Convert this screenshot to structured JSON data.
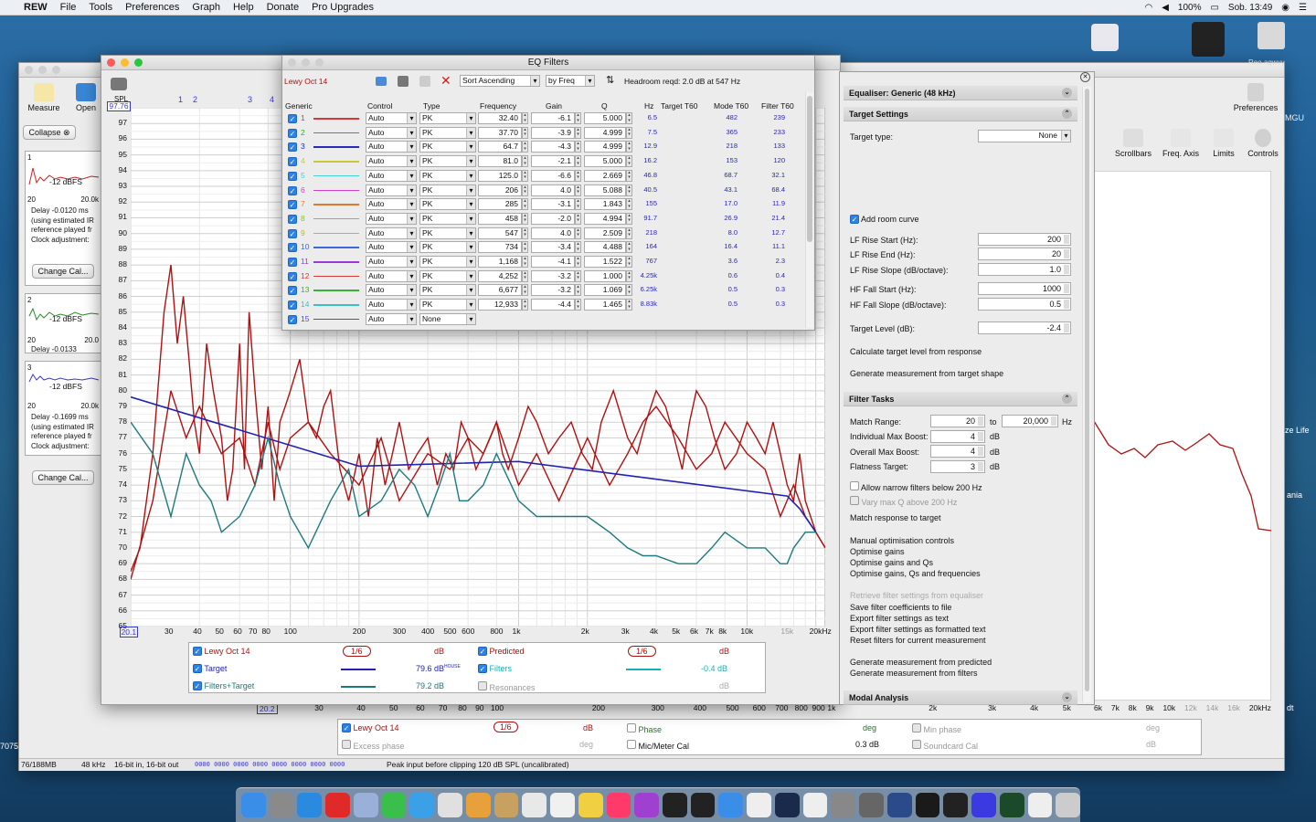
{
  "menubar": {
    "app": "REW",
    "items": [
      "File",
      "Tools",
      "Preferences",
      "Graph",
      "Help",
      "Donate",
      "Pro Upgrades"
    ],
    "battery": "100%",
    "clock": "Sob. 13:49"
  },
  "main_window": {
    "toolbar_left": {
      "measure": "Measure",
      "open": "Open",
      "collapse": "Collapse"
    },
    "toolbar_right": {
      "preferences": "Preferences",
      "scrollbars": "Scrollbars",
      "freq_axis": "Freq. Axis",
      "limits": "Limits",
      "controls": "Controls"
    },
    "thumbs": [
      {
        "num": "1",
        "level": "-12 dBFS",
        "lo": "20",
        "hi": "20.0k",
        "text": "Delay -0.0120 ms (using estimated IR reference played fr Clock adjustment:",
        "btn": "Change Cal..."
      },
      {
        "num": "2",
        "level": "-12 dBFS",
        "lo": "20",
        "hi": "20.0",
        "text": "Delay -0.0133",
        "btn": ""
      },
      {
        "num": "3",
        "level": "-12 dBFS",
        "lo": "20",
        "hi": "20.0k",
        "text": "Delay -0.1699 ms (using estimated IR reference played fr Clock adjustment:",
        "btn": "Change Cal..."
      }
    ],
    "status": {
      "mem": "76/188MB",
      "rate": "48 kHz",
      "bits": "16-bit in, 16-bit out",
      "bin": "0000 0000  0000 0000  0000 0000  0000 0000",
      "peak": "Peak input before clipping 120 dB SPL (uncalibrated)"
    },
    "bottom_axis": [
      "20.2",
      "30",
      "40",
      "50",
      "60",
      "70",
      "80",
      "90",
      "100",
      "200",
      "300",
      "400",
      "500",
      "600",
      "700",
      "800",
      "900",
      "1k",
      "2k",
      "3k",
      "4k",
      "5k",
      "6k",
      "7k",
      "8k",
      "9k",
      "10k",
      "12k",
      "14k",
      "16k",
      "20kHz"
    ],
    "bottom_legend": [
      {
        "label": "Lewy Oct 14",
        "value": "dB",
        "ctrl": "1/6",
        "checked": true,
        "color": "#b01010"
      },
      {
        "label": "Phase",
        "value": "deg",
        "checked": false,
        "color": "#1d7a1d"
      },
      {
        "label": "Min phase",
        "value": "deg",
        "checked": true,
        "disabled": true
      },
      {
        "label": "Excess phase",
        "value": "deg",
        "checked": true,
        "disabled": true
      },
      {
        "label": "Mic/Meter Cal",
        "value": "0.3 dB",
        "checked": false
      },
      {
        "label": "Soundcard Cal",
        "value": "dB",
        "checked": true,
        "disabled": true
      }
    ],
    "side_text": {
      "a": "Reo agwyy",
      "b": "MGU",
      "c": "ze Life",
      "d": "ania",
      "e": "dt",
      "f": "7075"
    }
  },
  "graph_window": {
    "spl_label": "SPL",
    "cursor_value": "97.76",
    "markers": [
      "1",
      "2",
      "3",
      "4"
    ],
    "y_ticks": [
      "97",
      "96",
      "95",
      "94",
      "93",
      "92",
      "91",
      "90",
      "89",
      "88",
      "87",
      "86",
      "85",
      "84",
      "83",
      "82",
      "81",
      "80",
      "79",
      "78",
      "77",
      "76",
      "75",
      "74",
      "73",
      "72",
      "71",
      "70",
      "69",
      "68",
      "67",
      "66",
      "65"
    ],
    "x_ticks": [
      "20.1",
      "30",
      "40",
      "50",
      "60",
      "70",
      "80",
      "100",
      "200",
      "300",
      "400",
      "500",
      "600",
      "800",
      "1k",
      "2k",
      "3k",
      "4k",
      "5k",
      "6k",
      "7k",
      "8k",
      "10k",
      "15k",
      "20kHz"
    ],
    "legend": [
      {
        "label": "Lewy Oct 14",
        "ctrl": "1/6",
        "value": "dB",
        "color": "#b01010"
      },
      {
        "label": "Predicted",
        "ctrl": "1/6",
        "value": "dB",
        "color": "#b01010"
      },
      {
        "label": "Target",
        "value": "79.6 dB",
        "sup": "HOUSE",
        "color": "#2222b0"
      },
      {
        "label": "Filters",
        "value": "-0.4 dB",
        "color": "#1bb0b0"
      },
      {
        "label": "Filters+Target",
        "value": "79.2 dB",
        "color": "#1b7a80"
      },
      {
        "label": "Resonances",
        "value": "dB",
        "color": "#999999"
      }
    ]
  },
  "eq_window": {
    "title": "EQ Filters",
    "measurement": "Lewy Oct 14",
    "sort": "Sort Ascending",
    "by": "by Freq",
    "headroom": "Headroom reqd:   2.0 dB at 547 Hz",
    "headers": [
      "Generic",
      "Control",
      "Type",
      "Frequency",
      "Gain",
      "Q",
      "Hz",
      "Target T60",
      "Mode T60",
      "Filter T60"
    ],
    "rows": [
      {
        "n": "1",
        "color": "#d23a3a",
        "control": "Auto",
        "type": "PK",
        "freq": "32.40",
        "gain": "-6.1",
        "q": "5.000",
        "hz": "6.5",
        "mode": "482",
        "filter": "239"
      },
      {
        "n": "2",
        "color": "#3aa33a",
        "control": "Auto",
        "type": "PK",
        "freq": "37.70",
        "gain": "-3.9",
        "q": "4.999",
        "hz": "7.5",
        "mode": "365",
        "filter": "233"
      },
      {
        "n": "3",
        "color": "#2a2ab8",
        "control": "Auto",
        "type": "PK",
        "freq": "64.7",
        "gain": "-4.3",
        "q": "4.999",
        "hz": "12.9",
        "mode": "218",
        "filter": "133"
      },
      {
        "n": "4",
        "color": "#c8c83a",
        "control": "Auto",
        "type": "PK",
        "freq": "81.0",
        "gain": "-2.1",
        "q": "5.000",
        "hz": "16.2",
        "mode": "153",
        "filter": "120"
      },
      {
        "n": "5",
        "color": "#45d0d0",
        "control": "Auto",
        "type": "PK",
        "freq": "125.0",
        "gain": "-6.6",
        "q": "2.669",
        "hz": "46.8",
        "mode": "68.7",
        "filter": "32.1"
      },
      {
        "n": "6",
        "color": "#d040d0",
        "control": "Auto",
        "type": "PK",
        "freq": "206",
        "gain": "4.0",
        "q": "5.088",
        "hz": "40.5",
        "mode": "43.1",
        "filter": "68.4"
      },
      {
        "n": "7",
        "color": "#e07a30",
        "control": "Auto",
        "type": "PK",
        "freq": "285",
        "gain": "-3.1",
        "q": "1.843",
        "hz": "155",
        "mode": "17.0",
        "filter": "11.9"
      },
      {
        "n": "8",
        "color": "#8ac03a",
        "control": "Auto",
        "type": "PK",
        "freq": "458",
        "gain": "-2.0",
        "q": "4.994",
        "hz": "91.7",
        "mode": "26.9",
        "filter": "21.4"
      },
      {
        "n": "9",
        "color": "#b8b83a",
        "control": "Auto",
        "type": "PK",
        "freq": "547",
        "gain": "4.0",
        "q": "2.509",
        "hz": "218",
        "mode": "8.0",
        "filter": "12.7"
      },
      {
        "n": "10",
        "color": "#3a6ad0",
        "control": "Auto",
        "type": "PK",
        "freq": "734",
        "gain": "-3.4",
        "q": "4.488",
        "hz": "164",
        "mode": "16.4",
        "filter": "11.1"
      },
      {
        "n": "11",
        "color": "#9a3ad0",
        "control": "Auto",
        "type": "PK",
        "freq": "1,168",
        "gain": "-4.1",
        "q": "1.522",
        "hz": "767",
        "mode": "3.6",
        "filter": "2.3"
      },
      {
        "n": "12",
        "color": "#d03a3a",
        "control": "Auto",
        "type": "PK",
        "freq": "4,252",
        "gain": "-3.2",
        "q": "1.000",
        "hz": "4.25k",
        "mode": "0.6",
        "filter": "0.4"
      },
      {
        "n": "13",
        "color": "#3ab03a",
        "control": "Auto",
        "type": "PK",
        "freq": "6,677",
        "gain": "-3.2",
        "q": "1.069",
        "hz": "6.25k",
        "mode": "0.5",
        "filter": "0.3"
      },
      {
        "n": "14",
        "color": "#3ac0c0",
        "control": "Auto",
        "type": "PK",
        "freq": "12,933",
        "gain": "-4.4",
        "q": "1.465",
        "hz": "8.83k",
        "mode": "0.5",
        "filter": "0.3"
      },
      {
        "n": "15",
        "color": "#4a4ad0",
        "control": "Auto",
        "type": "None",
        "freq": "",
        "gain": "",
        "q": "",
        "hz": "",
        "mode": "",
        "filter": ""
      }
    ]
  },
  "right_panel": {
    "equaliser": "Equaliser: Generic (48 kHz)",
    "target_settings": "Target Settings",
    "target_type_label": "Target type:",
    "target_type": "None",
    "add_room_curve": "Add room curve",
    "fields": [
      {
        "label": "LF Rise Start (Hz):",
        "value": "200"
      },
      {
        "label": "LF Rise End (Hz):",
        "value": "20"
      },
      {
        "label": "LF Rise Slope (dB/octave):",
        "value": "1.0"
      },
      {
        "label": "HF Fall Start (Hz):",
        "value": "1000"
      },
      {
        "label": "HF Fall Slope (dB/octave):",
        "value": "0.5"
      },
      {
        "label": "Target Level (dB):",
        "value": "-2.4"
      }
    ],
    "calc_target": "Calculate target level from response",
    "gen_target": "Generate measurement from target shape",
    "filter_tasks": "Filter Tasks",
    "match_range_label": "Match Range:",
    "match_lo": "20",
    "match_to": "to",
    "match_hi": "20,000",
    "hz": "Hz",
    "ind_boost_label": "Individual Max Boost:",
    "ind_boost": "4",
    "ovr_boost_label": "Overall Max Boost:",
    "ovr_boost": "4",
    "flat_label": "Flatness Target:",
    "flat": "3",
    "db": "dB",
    "allow_narrow": "Allow narrow filters below 200 Hz",
    "vary_q": "Vary max Q above 200 Hz",
    "match_response": "Match response to target",
    "manual": "Manual optimisation controls",
    "opt_gains": "Optimise gains",
    "opt_gains_qs": "Optimise gains and Qs",
    "opt_all": "Optimise gains, Qs and frequencies",
    "retrieve": "Retrieve filter settings from equaliser",
    "save_coeffs": "Save filter coefficients to file",
    "export_text": "Export filter settings as text",
    "export_fmt": "Export filter settings as formatted text",
    "reset": "Reset filters for current measurement",
    "gen_predicted": "Generate measurement from predicted",
    "gen_filters": "Generate measurement from filters",
    "modal": "Modal Analysis"
  },
  "chart_data": {
    "type": "line",
    "xscale": "log",
    "xlim": [
      20,
      22000
    ],
    "ylim": [
      65,
      98
    ],
    "ylabel": "SPL",
    "grid": true,
    "series": [
      {
        "name": "Lewy Oct 14",
        "color": "#b01010",
        "x": [
          20,
          22,
          25,
          28,
          30,
          32,
          34,
          36,
          38,
          40,
          43,
          46,
          50,
          53,
          56,
          60,
          63,
          66,
          70,
          75,
          80,
          85,
          90,
          95,
          100,
          110,
          120,
          130,
          140,
          150,
          165,
          180,
          200,
          220,
          240,
          260,
          280,
          300,
          330,
          360,
          400,
          440,
          480,
          520,
          560,
          600,
          650,
          700,
          750,
          800,
          850,
          900,
          1000,
          1100,
          1200,
          1350,
          1500,
          1700,
          1900,
          2100,
          2300,
          2600,
          3000,
          3300,
          3600,
          4000,
          4400,
          4800,
          5200,
          5600,
          6000,
          6600,
          7200,
          8000,
          9000,
          10000,
          11000,
          12000,
          13000,
          14000,
          15000,
          16000,
          17000,
          18000,
          20000,
          22000
        ],
        "y": [
          68.5,
          70,
          76,
          85,
          88,
          83,
          86,
          82,
          78,
          76,
          83,
          80,
          77,
          73,
          75,
          83,
          75,
          85,
          80,
          75,
          79,
          73,
          78,
          79,
          80,
          82,
          78,
          77,
          79,
          80,
          75,
          73,
          76,
          72,
          77,
          74,
          76,
          78,
          75,
          76,
          77,
          74,
          76,
          75,
          78,
          77,
          75,
          76,
          77,
          78,
          76,
          75,
          77,
          79,
          78,
          76,
          77,
          78,
          76,
          75,
          78,
          80,
          77,
          76,
          78,
          80,
          79,
          77,
          75,
          78,
          80,
          79,
          77,
          75,
          76,
          78,
          77,
          76,
          78,
          76,
          74,
          73,
          76,
          73,
          71,
          70
        ]
      },
      {
        "name": "Predicted",
        "color": "#b01010",
        "x": [
          20,
          25,
          30,
          35,
          40,
          50,
          60,
          70,
          80,
          90,
          100,
          120,
          150,
          200,
          250,
          300,
          400,
          500,
          600,
          700,
          800,
          1000,
          1200,
          1500,
          2000,
          2500,
          3000,
          3500,
          4000,
          5000,
          6000,
          7000,
          8000,
          10000,
          12000,
          14000,
          16000,
          18000,
          20000,
          22000
        ],
        "y": [
          68,
          73,
          80,
          77,
          79,
          76,
          77,
          74,
          78,
          75,
          77,
          78,
          76,
          74,
          77,
          73,
          76,
          75,
          77,
          76,
          78,
          74,
          76,
          73,
          77,
          74,
          76,
          78,
          79,
          77,
          75,
          76,
          78,
          76,
          75,
          72,
          74,
          72,
          71,
          70
        ]
      },
      {
        "name": "Target",
        "color": "#2222b0",
        "x": [
          20,
          200,
          1000,
          15000,
          17000,
          20000
        ],
        "y": [
          79.6,
          75.2,
          75.5,
          73.3,
          72.5,
          71
        ]
      },
      {
        "name": "Filters+Target",
        "color": "#1b7a80",
        "x": [
          20,
          25,
          30,
          35,
          40,
          45,
          50,
          60,
          70,
          80,
          90,
          100,
          120,
          150,
          180,
          200,
          250,
          300,
          350,
          400,
          450,
          500,
          550,
          600,
          700,
          800,
          1000,
          1200,
          1500,
          2000,
          2500,
          3000,
          3500,
          4000,
          5000,
          6000,
          7000,
          8000,
          10000,
          12000,
          14000,
          15000,
          16000,
          18000,
          20000
        ],
        "y": [
          78,
          76,
          72,
          76,
          74,
          73,
          71,
          72,
          74,
          77,
          74,
          72,
          70,
          73,
          75,
          72,
          73,
          75,
          74,
          72,
          74,
          76,
          73,
          73,
          74,
          76,
          73,
          72,
          72,
          72,
          71,
          70,
          69.5,
          69.5,
          69,
          69,
          70,
          71,
          70,
          70,
          69,
          69,
          70,
          71,
          71
        ]
      }
    ]
  }
}
